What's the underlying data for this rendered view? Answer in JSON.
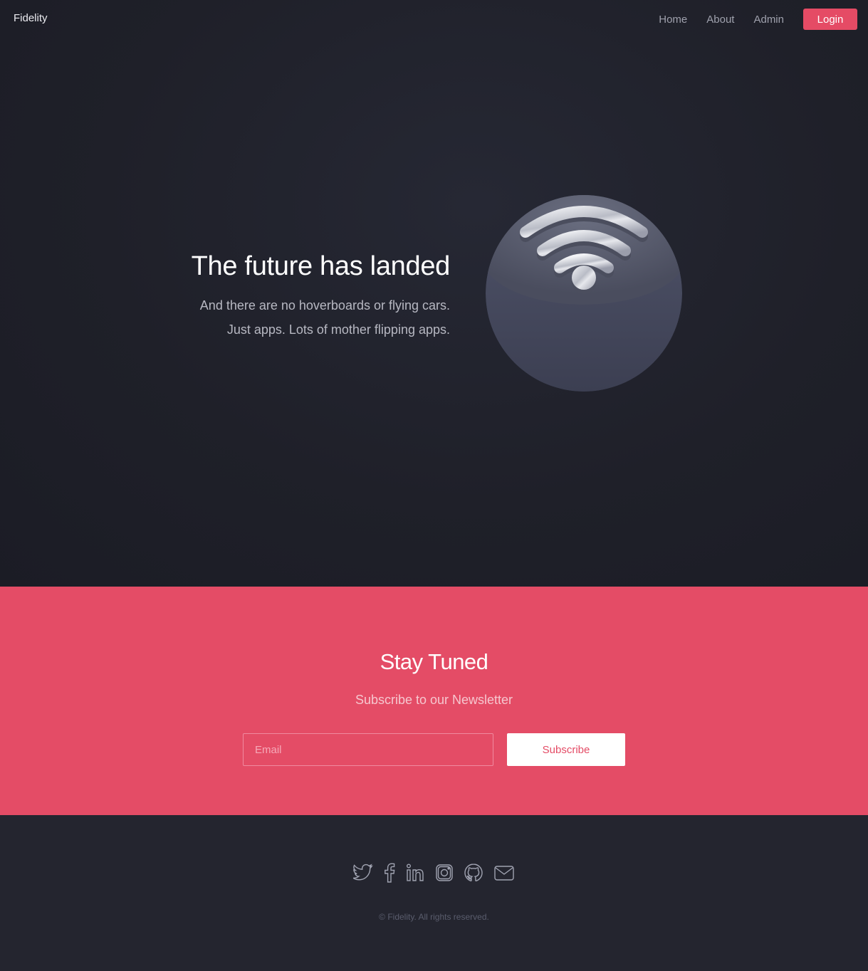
{
  "nav": {
    "brand": "Fidelity",
    "links": [
      "Home",
      "About",
      "Admin"
    ],
    "login_label": "Login"
  },
  "hero": {
    "title": "The future has landed",
    "subtitle_line1": "And there are no hoverboards or flying cars.",
    "subtitle_line2": "Just apps. Lots of mother flipping apps.",
    "graphic_icon": "wifi-icon"
  },
  "newsletter": {
    "title": "Stay Tuned",
    "subtitle": "Subscribe to our Newsletter",
    "email_placeholder": "Email",
    "subscribe_label": "Subscribe"
  },
  "footer": {
    "socials": [
      "twitter-icon",
      "facebook-icon",
      "linkedin-icon",
      "instagram-icon",
      "github-icon",
      "email-icon"
    ],
    "copyright": "© Fidelity. All rights reserved."
  },
  "colors": {
    "accent": "#e44c66",
    "hero_bg": "#1f2029",
    "footer_bg": "#24252f"
  }
}
